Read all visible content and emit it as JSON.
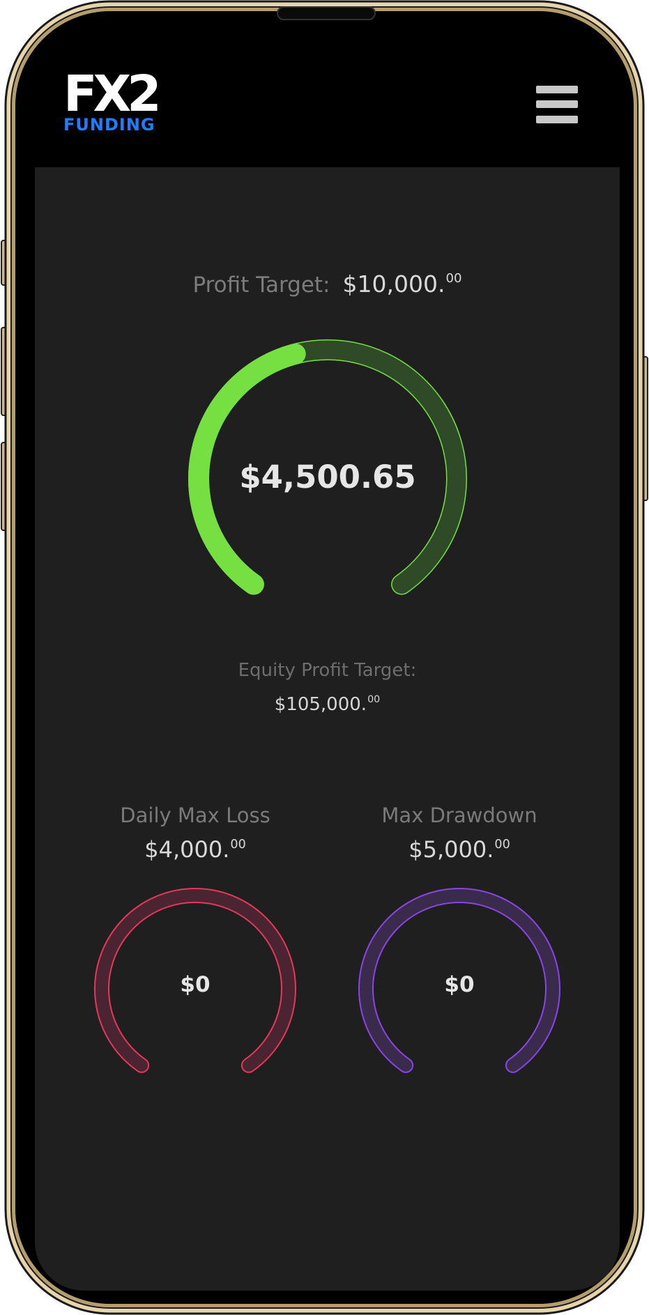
{
  "header": {
    "logo_main": "FX2",
    "logo_sub": "FUNDING",
    "menu_icon": "hamburger-menu-icon"
  },
  "profit_target": {
    "label": "Profit Target:",
    "value_main": "$10,000.",
    "value_cents": "00"
  },
  "main_gauge": {
    "value": "$4,500.65",
    "progress_fraction": 0.45,
    "color_fill": "#76e043",
    "color_track": "#2f4a27",
    "color_track_outline": "#77e044"
  },
  "equity": {
    "label": "Equity Profit Target:",
    "value_main": "$105,000.",
    "value_cents": "00"
  },
  "daily_max_loss": {
    "label": "Daily Max Loss",
    "value_main": "$4,000.",
    "value_cents": "00",
    "gauge_value": "$0",
    "progress_fraction": 0,
    "color": "#e6375d",
    "color_track": "#4a2430"
  },
  "max_drawdown": {
    "label": "Max Drawdown",
    "value_main": "$5,000.",
    "value_cents": "00",
    "gauge_value": "$0",
    "progress_fraction": 0,
    "color": "#8a45e6",
    "color_track": "#3a2a4c"
  },
  "colors": {
    "background": "#1f1f1f",
    "header": "#000000",
    "device_frame": "#d9c49a"
  }
}
